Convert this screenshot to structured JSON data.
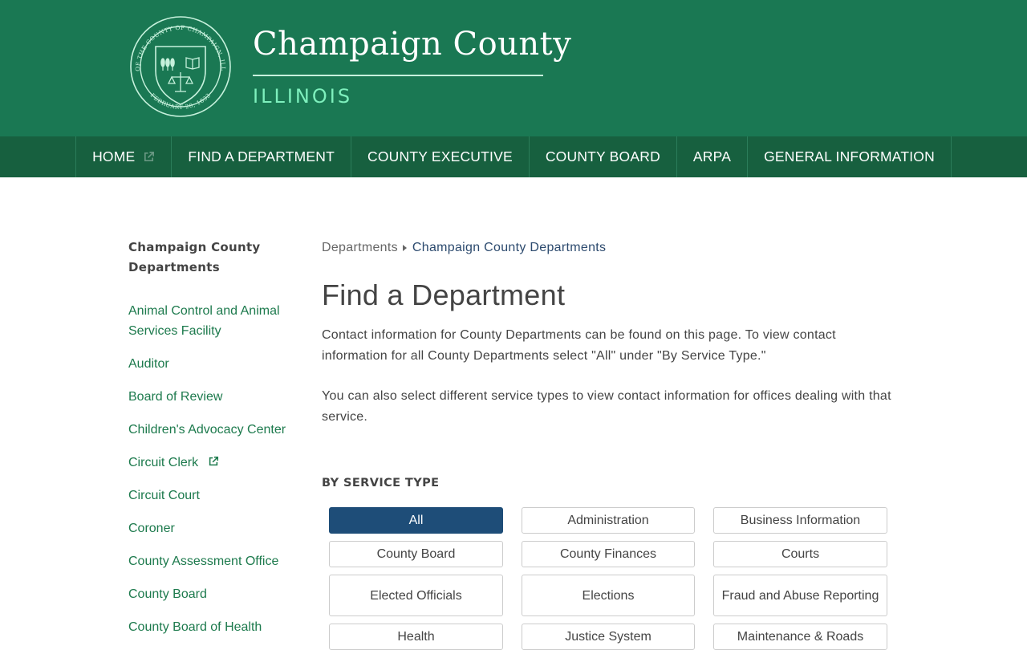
{
  "header": {
    "title": "Champaign County",
    "subtitle": "ILLINOIS",
    "seal": {
      "ring_text": "SEAL OF THE COUNTY OF CHAMPAIGN, ILLINOIS",
      "date_text": "FEBRUARY 20, 1833"
    }
  },
  "nav": {
    "items": [
      {
        "label": "HOME",
        "external": true
      },
      {
        "label": "FIND A DEPARTMENT"
      },
      {
        "label": "COUNTY EXECUTIVE"
      },
      {
        "label": "COUNTY BOARD"
      },
      {
        "label": "ARPA"
      },
      {
        "label": "GENERAL INFORMATION"
      }
    ]
  },
  "sidebar": {
    "title": "Champaign County Departments",
    "links": [
      {
        "label": "Animal Control and Animal Services Facility"
      },
      {
        "label": "Auditor"
      },
      {
        "label": "Board of Review"
      },
      {
        "label": "Children's Advocacy Center"
      },
      {
        "label": "Circuit Clerk",
        "external": true
      },
      {
        "label": "Circuit Court"
      },
      {
        "label": "Coroner"
      },
      {
        "label": "County Assessment Office"
      },
      {
        "label": "County Board"
      },
      {
        "label": "County Board of Health"
      }
    ]
  },
  "main": {
    "breadcrumb": {
      "home": "Departments",
      "current": "Champaign County Departments"
    },
    "title": "Find a Department",
    "intro_1": "Contact information for County Departments can be found on this page. To view contact information for all County Departments select \"All\" under \"By Service Type.\"",
    "intro_2": "You can also select different service types to view contact information for offices dealing with that service.",
    "service_heading": "BY SERVICE TYPE",
    "service_types": [
      {
        "label": "All",
        "selected": true
      },
      {
        "label": "Administration"
      },
      {
        "label": "Business Information"
      },
      {
        "label": "County Board"
      },
      {
        "label": "County Finances"
      },
      {
        "label": "Courts"
      },
      {
        "label": "Elected Officials"
      },
      {
        "label": "Elections"
      },
      {
        "label": "Fraud and Abuse Reporting"
      },
      {
        "label": "Health"
      },
      {
        "label": "Justice System"
      },
      {
        "label": "Maintenance & Roads"
      }
    ]
  },
  "colors": {
    "header_green": "#1a7853",
    "nav_green": "#17603f",
    "link_green": "#1d7a4d",
    "active_blue": "#1e4d78",
    "subtitle_mint": "#7ef0bd"
  }
}
